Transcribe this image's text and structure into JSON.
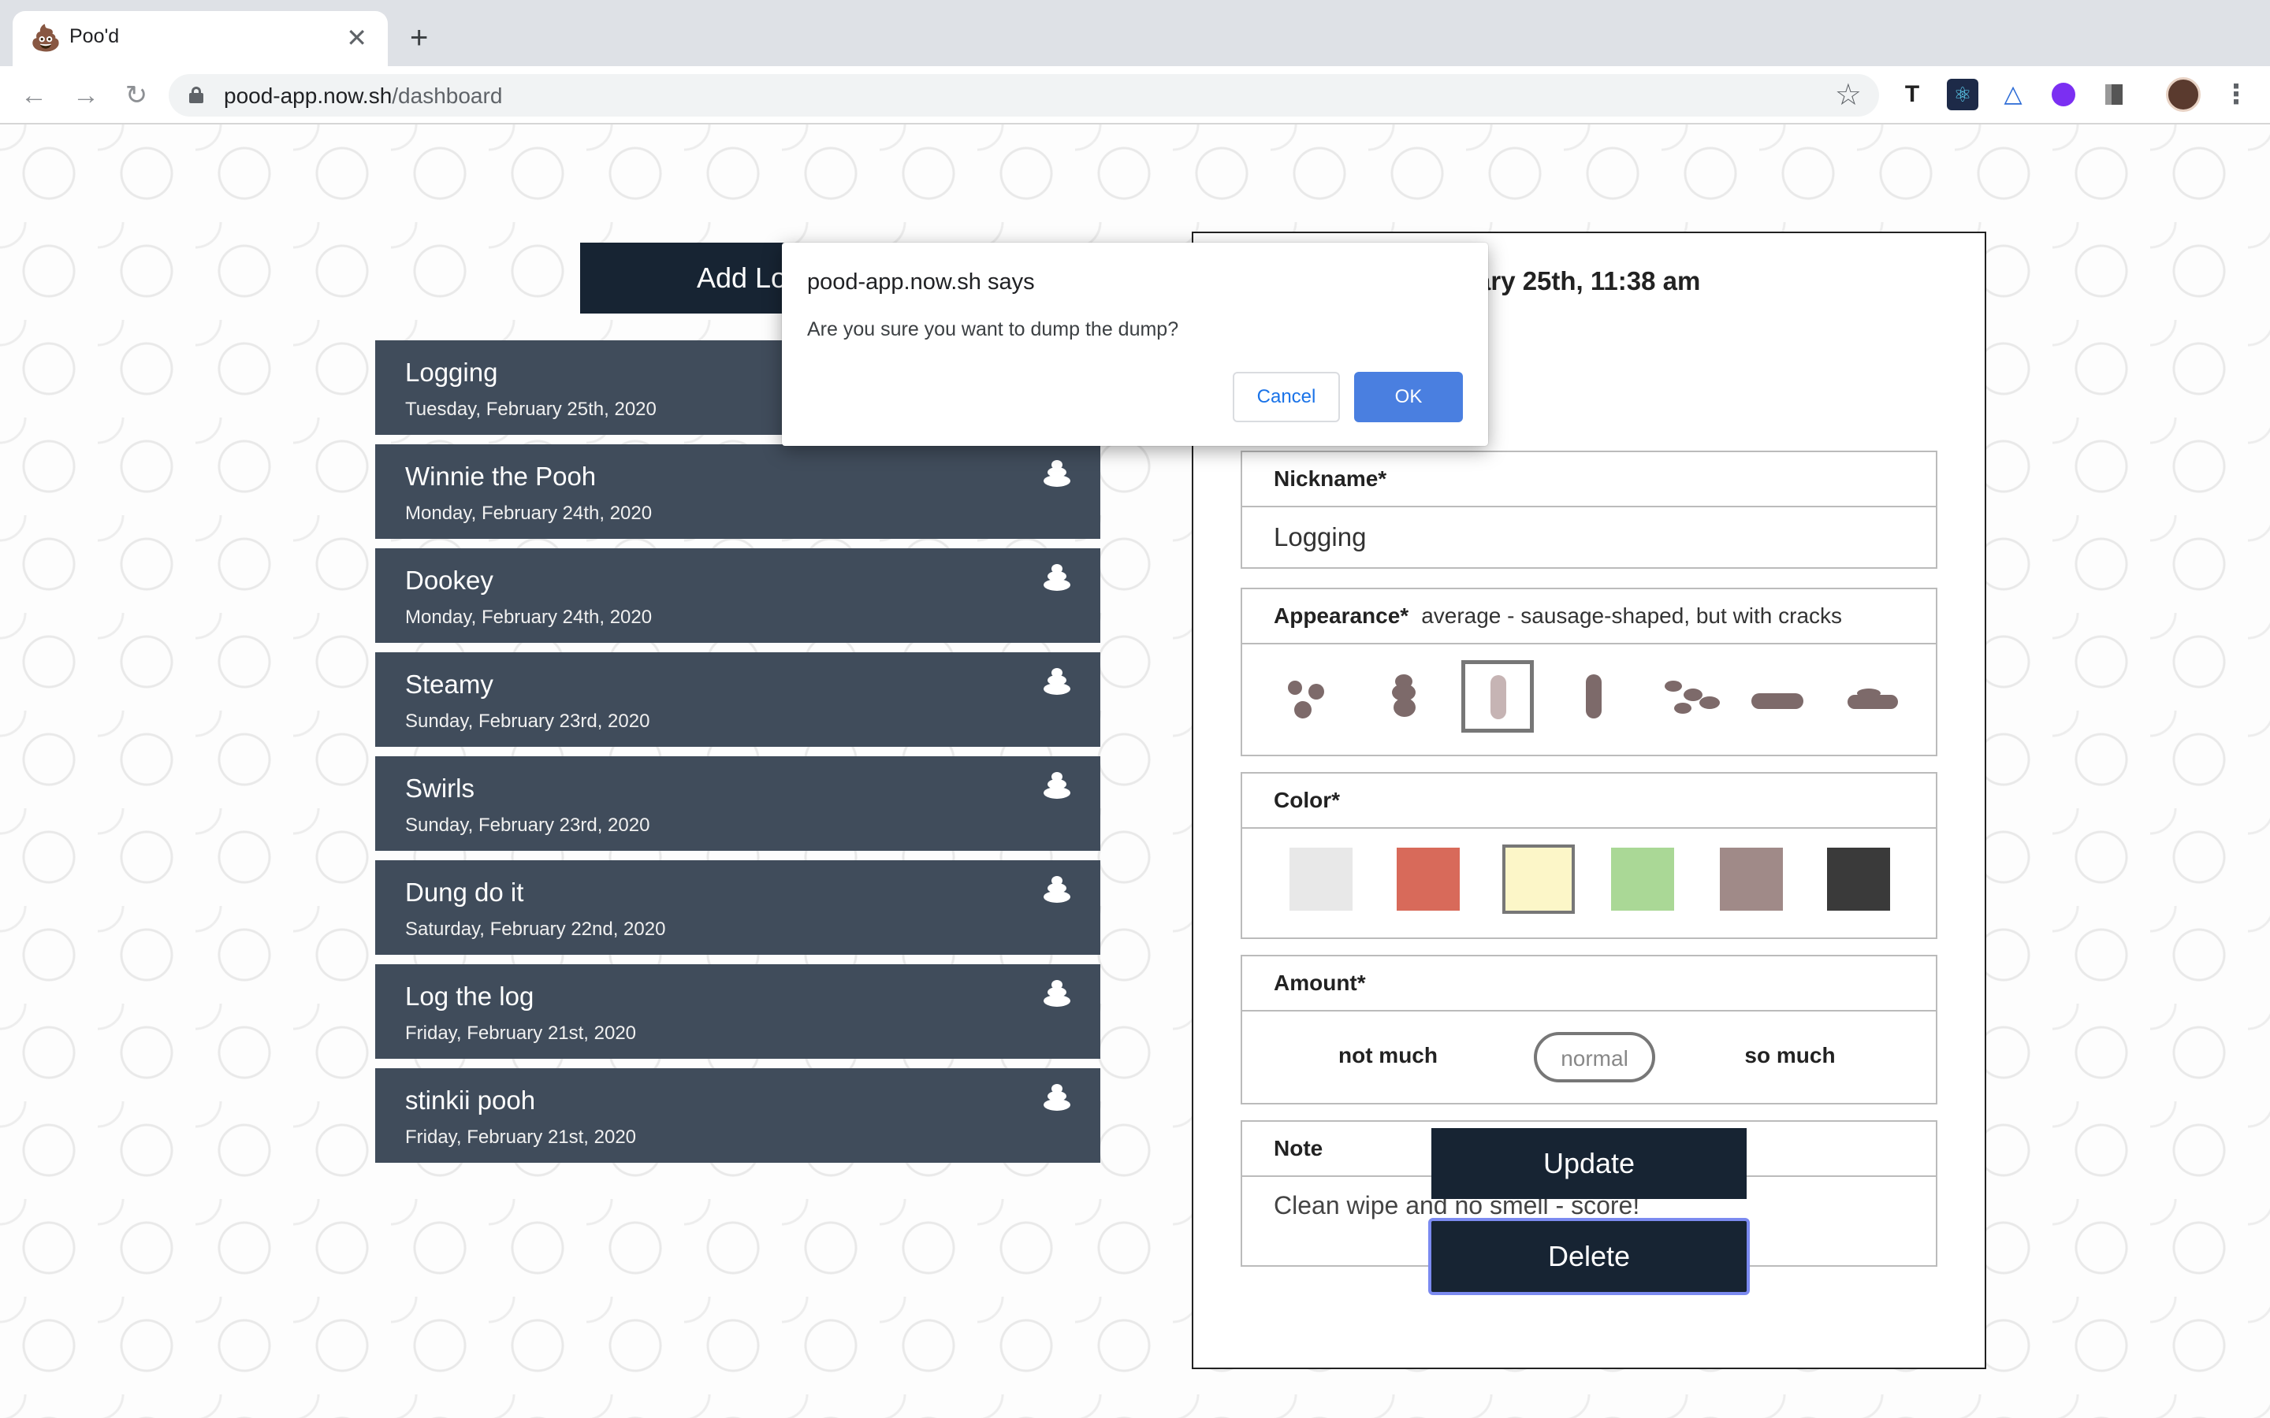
{
  "browser": {
    "tab_title": "Poo'd",
    "tab_favicon": "poop-emoji-icon",
    "url_host": "pood-app.now.sh",
    "url_path": "/dashboard",
    "extensions": [
      "typewriter-icon",
      "react-icon",
      "triangle-icon",
      "purple-circle-icon",
      "book-icon"
    ]
  },
  "dashboard": {
    "add_log_label": "Add Log",
    "logs": [
      {
        "name": "Logging",
        "date": "Tuesday, February 25th, 2020"
      },
      {
        "name": "Winnie the Pooh",
        "date": "Monday, February 24th, 2020"
      },
      {
        "name": "Dookey",
        "date": "Monday, February 24th, 2020"
      },
      {
        "name": "Steamy",
        "date": "Sunday, February 23rd, 2020"
      },
      {
        "name": "Swirls",
        "date": "Sunday, February 23rd, 2020"
      },
      {
        "name": "Dung do it",
        "date": "Saturday, February 22nd, 2020"
      },
      {
        "name": "Log the log",
        "date": "Friday, February 21st, 2020"
      },
      {
        "name": "stinkii pooh",
        "date": "Friday, February 21st, 2020"
      }
    ]
  },
  "detail": {
    "date_heading": "Tuesday, February 25th, 11:38 am",
    "nickname_label": "Nickname*",
    "nickname_value": "Logging",
    "appearance_label": "Appearance*",
    "appearance_value": "average - sausage-shaped, but with cracks",
    "appearance_selected_index": 2,
    "color_label": "Color*",
    "colors": [
      "#e8e8e8",
      "#d86a5a",
      "#fcf6c8",
      "#aad896",
      "#a08a88",
      "#3a3a3a"
    ],
    "color_selected_index": 2,
    "amount_label": "Amount*",
    "amount_options": [
      "not much",
      "normal",
      "so much"
    ],
    "amount_selected": "normal",
    "note_label": "Note",
    "note_value": "Clean wipe and no smell - score!",
    "update_label": "Update",
    "delete_label": "Delete"
  },
  "dialog": {
    "title": "pood-app.now.sh says",
    "message": "Are you sure you want to dump the dump?",
    "cancel_label": "Cancel",
    "ok_label": "OK"
  }
}
